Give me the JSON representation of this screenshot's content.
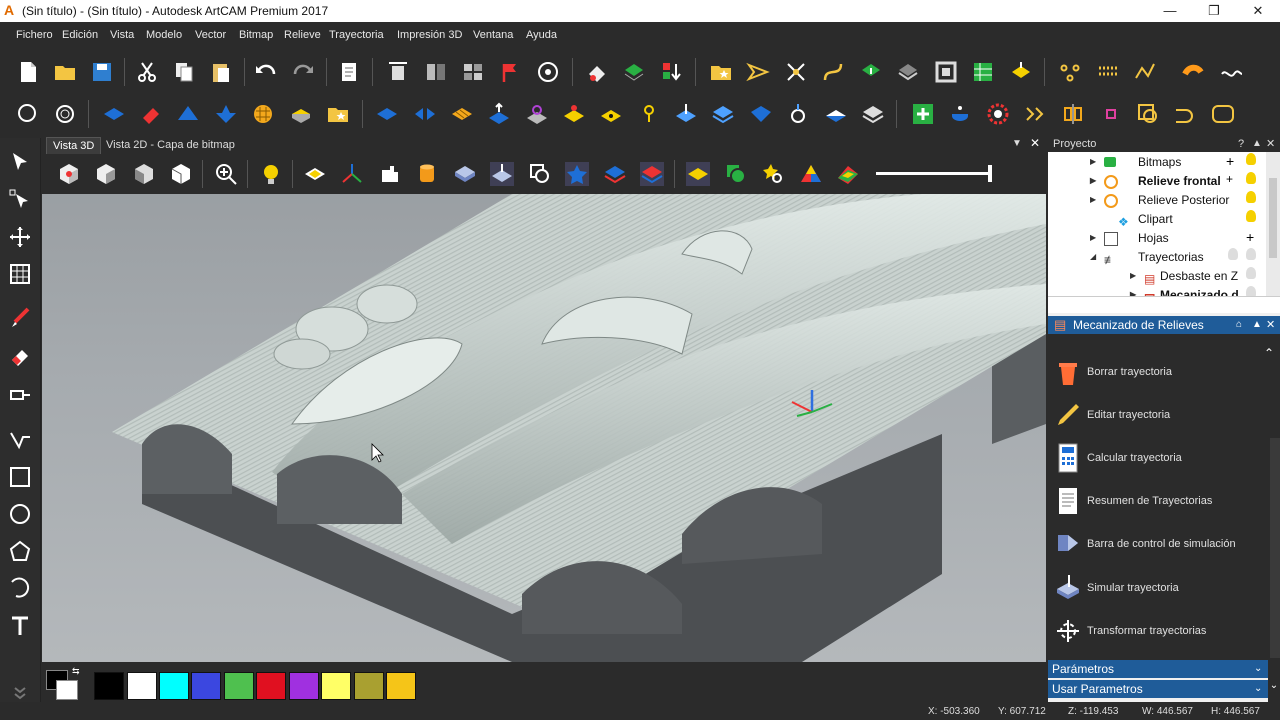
{
  "window": {
    "title": "(Sin título) - (Sin título) - Autodesk ArtCAM Premium 2017"
  },
  "menu": [
    "Fichero",
    "Edición",
    "Vista",
    "Modelo",
    "Vector",
    "Bitmap",
    "Relieve",
    "Trayectoria",
    "Impresión 3D",
    "Ventana",
    "Ayuda"
  ],
  "tabs": [
    {
      "label": "Vista 3D",
      "active": true
    },
    {
      "label": "Vista 2D - Capa de bitmap",
      "active": false
    }
  ],
  "project_panel": {
    "title": "Proyecto",
    "tree": [
      {
        "label": "Bitmaps",
        "bold": false
      },
      {
        "label": "Relieve frontal",
        "bold": true
      },
      {
        "label": "Relieve Posterior",
        "bold": false
      },
      {
        "label": "Clipart",
        "bold": false
      },
      {
        "label": "Hojas",
        "bold": false
      },
      {
        "label": "Trayectorias",
        "bold": false
      },
      {
        "label": "Desbaste en Z",
        "bold": false
      },
      {
        "label": "Mecanizado d...",
        "bold": true
      }
    ]
  },
  "toolpath_panel": {
    "title": "Mecanizado de Relieves",
    "items": [
      {
        "label": "Borrar trayectoria",
        "icon": "trash-icon"
      },
      {
        "label": "Editar trayectoria",
        "icon": "pencil-icon"
      },
      {
        "label": "Calcular trayectoria",
        "icon": "calculator-icon"
      },
      {
        "label": "Resumen de Trayectorias",
        "icon": "document-icon"
      },
      {
        "label": "Barra de control de simulación",
        "icon": "simulation-bar-icon"
      },
      {
        "label": "Simular trayectoria",
        "icon": "simulate-icon"
      },
      {
        "label": "Transformar trayectorias",
        "icon": "transform-icon"
      }
    ],
    "sections": [
      "Parámetros",
      "Usar Parametros"
    ]
  },
  "palette": [
    "#000000",
    "#ffffff",
    "#00ffff",
    "#3b47e0",
    "#4fc04f",
    "#e01020",
    "#a030e0",
    "#ffff66",
    "#a9a030",
    "#f5c518"
  ],
  "status": {
    "x": "X: -503.360",
    "y": "Y: 607.712",
    "z": "Z: -119.453",
    "w": "W: 446.567",
    "h": "H: 446.567"
  },
  "colors": {
    "accent_blue": "#1f5c99",
    "panel_dark": "#2b2b2b"
  }
}
